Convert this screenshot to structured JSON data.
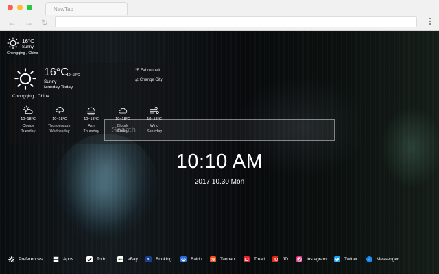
{
  "browser": {
    "tab_title": "NewTab",
    "back_glyph": "←",
    "forward_glyph": "→",
    "reload_glyph": "↻"
  },
  "mini_weather": {
    "temperature": "16°C",
    "condition": "Sunny",
    "city": "Chongqing , China",
    "icon": "sun-icon"
  },
  "weather": {
    "temperature": "16°C",
    "range": "10~18°C",
    "condition": "Sunny",
    "day": "Monday Today",
    "city": "Chongqing , China",
    "fahrenheit_label": "°F  Fahrenheit",
    "change_city_label": "⇄  Change City",
    "forecast": [
      {
        "range": "10~18°C",
        "condition": "Cloudy",
        "day": "Tuesday",
        "icon": "cloud-sun-icon"
      },
      {
        "range": "10~18°C",
        "condition": "Thunderstorm",
        "day": "Wednesday",
        "icon": "thunderstorm-icon"
      },
      {
        "range": "10~18°C",
        "condition": "Ash",
        "day": "Thursday",
        "icon": "ash-icon"
      },
      {
        "range": "10~18°C",
        "condition": "Cloudy",
        "day": "Friday",
        "icon": "cloud-icon"
      },
      {
        "range": "10~18°C",
        "condition": "Wind",
        "day": "Saturday",
        "icon": "wind-icon"
      }
    ]
  },
  "search": {
    "placeholder": "Search"
  },
  "clock": {
    "time": "10:10 AM",
    "date": "2017.10.30 Mon"
  },
  "bottom_bar": {
    "items": [
      {
        "label": "Preferences",
        "icon": "gear-icon"
      },
      {
        "label": "Apps",
        "icon": "apps-grid-icon"
      },
      {
        "label": "Todo",
        "icon": "checkbox-icon"
      },
      {
        "label": "eBay",
        "icon": "ebay-icon"
      },
      {
        "label": "Booking",
        "icon": "booking-icon",
        "glyph": "b."
      },
      {
        "label": "Baidu",
        "icon": "baidu-icon"
      },
      {
        "label": "Taobao",
        "icon": "taobao-icon"
      },
      {
        "label": "Tmall",
        "icon": "tmall-icon"
      },
      {
        "label": "JD",
        "icon": "jd-icon"
      },
      {
        "label": "Instagram",
        "icon": "instagram-icon"
      },
      {
        "label": "Twitter",
        "icon": "twitter-icon"
      },
      {
        "label": "Messenger",
        "icon": "messenger-icon"
      }
    ]
  },
  "colors": {
    "booking": "#1c3d8f",
    "baidu": "#2a6de0",
    "taobao": "#f0521c",
    "tmall": "#e5232e",
    "jd": "#e1251b",
    "instagram": "#d8357c",
    "twitter": "#1da1f2",
    "messenger": "#1a8cf5"
  }
}
